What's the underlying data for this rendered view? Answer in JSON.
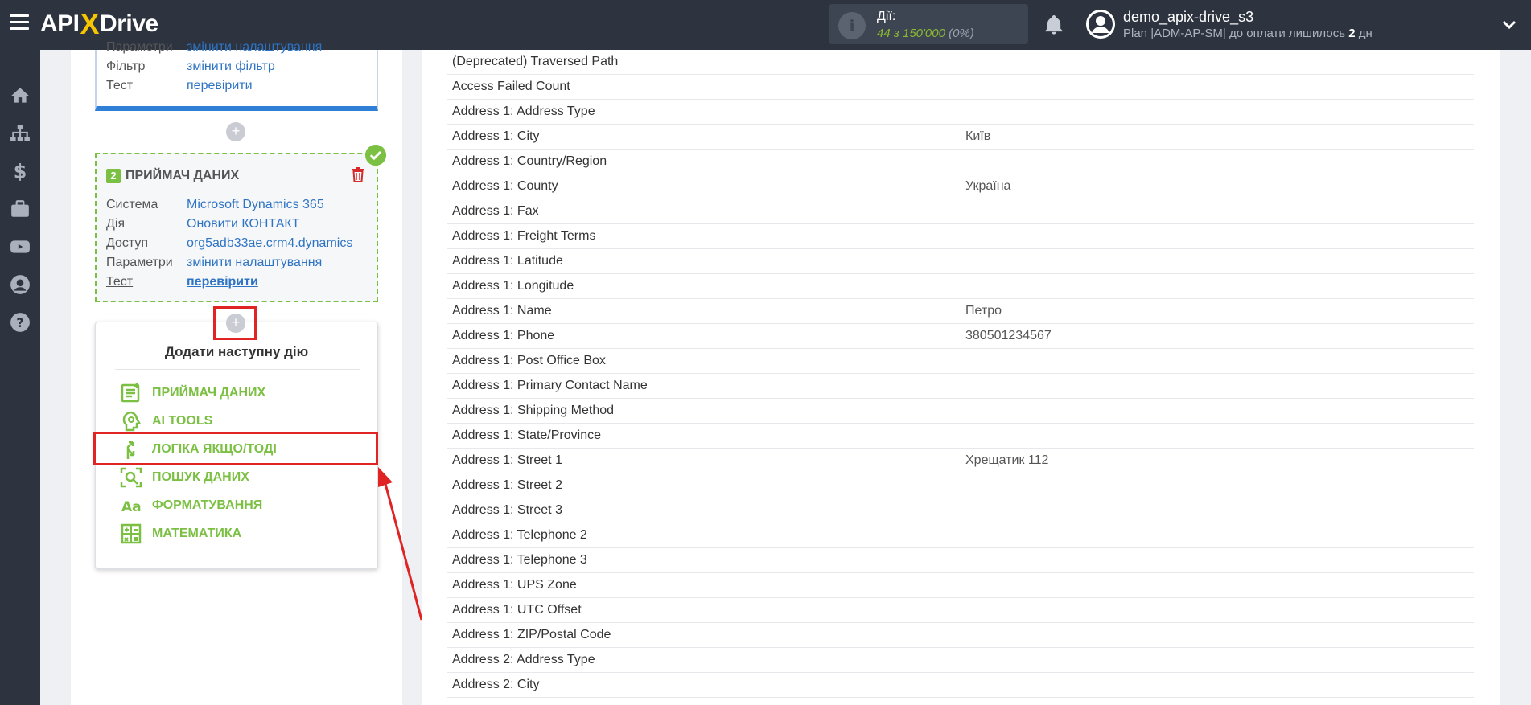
{
  "header": {
    "logo_left": "API",
    "logo_x": "X",
    "logo_right": "Drive",
    "actions_label": "Дії:",
    "actions_value": "44 з 150'000",
    "actions_pct": "(0%)",
    "user_name": "demo_apix-drive_s3",
    "user_plan_prefix": "Plan |ADM-AP-SM| до оплати лишилось ",
    "user_plan_days": "2",
    "user_plan_suffix": " дн"
  },
  "card1": {
    "rows": [
      {
        "key": "Параметри",
        "value": "змінити налаштування"
      },
      {
        "key": "Фільтр",
        "value": "змінити фільтр"
      },
      {
        "key": "Тест",
        "value": "перевірити"
      }
    ]
  },
  "card2": {
    "number": "2",
    "title": "ПРИЙМАЧ ДАНИХ",
    "rows": [
      {
        "key": "Система",
        "value": "Microsoft Dynamics 365"
      },
      {
        "key": "Дія",
        "value": "Оновити КОНТАКТ"
      },
      {
        "key": "Доступ",
        "value": "org5adb33ae.crm4.dynamics"
      },
      {
        "key": "Параметри",
        "value": "змінити налаштування"
      },
      {
        "key": "Тест",
        "value": "перевірити"
      }
    ]
  },
  "plus_symbol": "+",
  "add_action": {
    "title": "Додати наступну дію",
    "items": [
      {
        "label": "ПРИЙМАЧ ДАНИХ",
        "icon": "data-receiver-icon"
      },
      {
        "label": "AI TOOLS",
        "icon": "ai-tools-icon"
      },
      {
        "label": "ЛОГІКА ЯКЩО/ТОДІ",
        "icon": "logic-if-then-icon"
      },
      {
        "label": "ПОШУК ДАНИХ",
        "icon": "data-search-icon"
      },
      {
        "label": "ФОРМАТУВАННЯ",
        "icon": "formatting-icon"
      },
      {
        "label": "МАТЕМАТИКА",
        "icon": "math-icon"
      }
    ]
  },
  "fields": [
    {
      "name": "(Deprecated) Traversed Path",
      "value": ""
    },
    {
      "name": "Access Failed Count",
      "value": ""
    },
    {
      "name": "Address 1: Address Type",
      "value": ""
    },
    {
      "name": "Address 1: City",
      "value": "Київ"
    },
    {
      "name": "Address 1: Country/Region",
      "value": ""
    },
    {
      "name": "Address 1: County",
      "value": "Україна"
    },
    {
      "name": "Address 1: Fax",
      "value": ""
    },
    {
      "name": "Address 1: Freight Terms",
      "value": ""
    },
    {
      "name": "Address 1: Latitude",
      "value": ""
    },
    {
      "name": "Address 1: Longitude",
      "value": ""
    },
    {
      "name": "Address 1: Name",
      "value": "Петро"
    },
    {
      "name": "Address 1: Phone",
      "value": "380501234567"
    },
    {
      "name": "Address 1: Post Office Box",
      "value": ""
    },
    {
      "name": "Address 1: Primary Contact Name",
      "value": ""
    },
    {
      "name": "Address 1: Shipping Method",
      "value": ""
    },
    {
      "name": "Address 1: State/Province",
      "value": ""
    },
    {
      "name": "Address 1: Street 1",
      "value": "Хрещатик 112"
    },
    {
      "name": "Address 1: Street 2",
      "value": ""
    },
    {
      "name": "Address 1: Street 3",
      "value": ""
    },
    {
      "name": "Address 1: Telephone 2",
      "value": ""
    },
    {
      "name": "Address 1: Telephone 3",
      "value": ""
    },
    {
      "name": "Address 1: UPS Zone",
      "value": ""
    },
    {
      "name": "Address 1: UTC Offset",
      "value": ""
    },
    {
      "name": "Address 1: ZIP/Postal Code",
      "value": ""
    },
    {
      "name": "Address 2: Address Type",
      "value": ""
    },
    {
      "name": "Address 2: City",
      "value": ""
    }
  ],
  "colors": {
    "header_bg": "#2d3440",
    "accent_green": "#7bc043",
    "link_blue": "#2f74c4",
    "highlight_red": "#e02424",
    "logo_yellow": "#f7c400"
  }
}
